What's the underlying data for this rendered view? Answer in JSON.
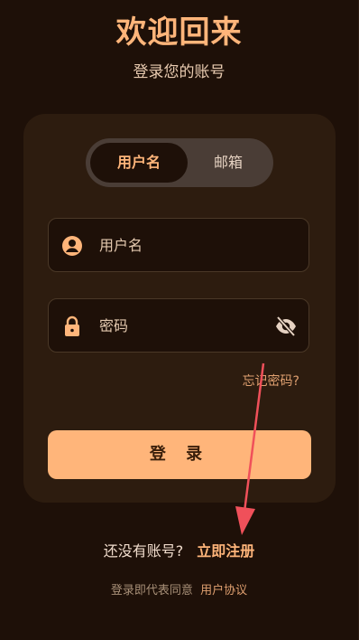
{
  "header": {
    "title": "欢迎回来",
    "subtitle": "登录您的账号"
  },
  "tabs": [
    {
      "label": "用户名",
      "active": true
    },
    {
      "label": "邮箱",
      "active": false
    }
  ],
  "form": {
    "username": {
      "placeholder": "用户名",
      "value": "",
      "icon": "user-circle-icon"
    },
    "password": {
      "placeholder": "密码",
      "value": "",
      "icon": "lock-icon",
      "toggle_icon": "eye-off-icon"
    },
    "forgot_label": "忘记密码?",
    "login_label": "登 录"
  },
  "footer": {
    "register_prompt": "还没有账号?",
    "register_link": "立即注册",
    "terms_prefix": "登录即代表同意",
    "terms_link": "用户协议"
  },
  "colors": {
    "background": "#1e1008",
    "card": "#2d1c0f",
    "accent": "#ffb57a",
    "annotation_arrow": "#f0505a"
  }
}
